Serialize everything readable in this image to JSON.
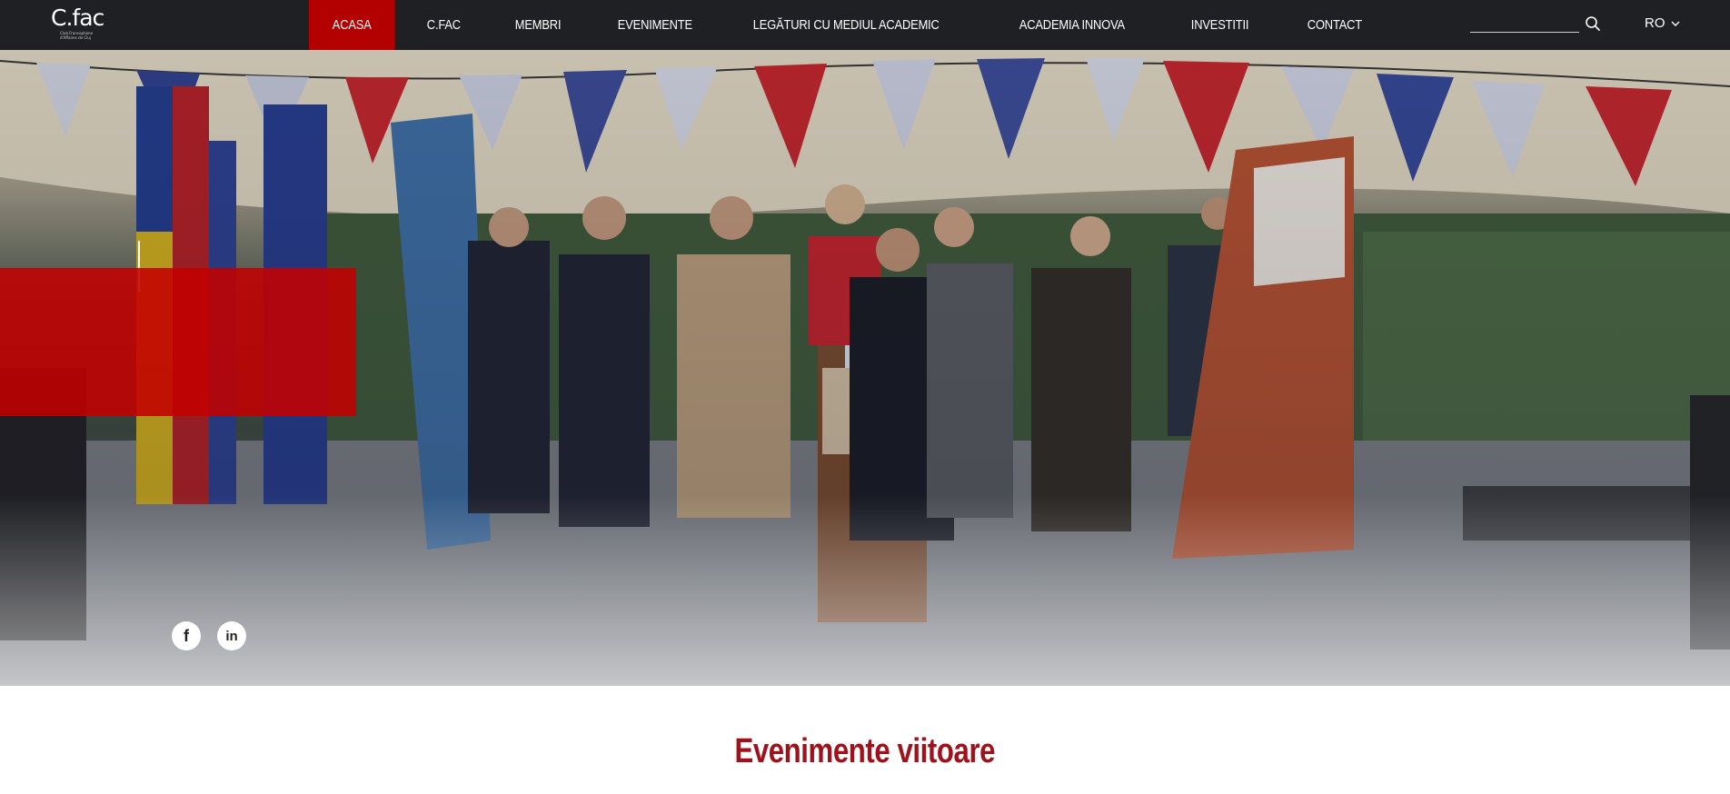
{
  "brand": {
    "logo_text": "C.fac",
    "logo_subtext": "Club Francophone d'Affaires de Cluj"
  },
  "nav": {
    "items": [
      {
        "label": "ACASA",
        "active": true
      },
      {
        "label": "C.FAC",
        "active": false
      },
      {
        "label": "MEMBRI",
        "active": false
      },
      {
        "label": "EVENIMENTE",
        "active": false
      },
      {
        "label": "LEGĂTURI CU MEDIUL ACADEMIC",
        "active": false
      },
      {
        "label": "ACADEMIA INNOVA",
        "active": false
      },
      {
        "label": "INVESTITII",
        "active": false
      },
      {
        "label": "CONTACT",
        "active": false
      }
    ],
    "search": {
      "value": "",
      "placeholder": "",
      "icon": "search-icon"
    },
    "language": {
      "value": "RO",
      "icon": "chevron-down-icon"
    }
  },
  "hero": {
    "social": [
      {
        "name": "facebook",
        "glyph": "f",
        "icon": "facebook-icon"
      },
      {
        "name": "linkedin",
        "glyph": "in",
        "icon": "linkedin-icon"
      }
    ]
  },
  "section": {
    "title": "Evenimente viitoare"
  },
  "colors": {
    "navbar_bg": "#1f2024",
    "accent_red": "#b30000",
    "title_red": "#a0121b"
  }
}
